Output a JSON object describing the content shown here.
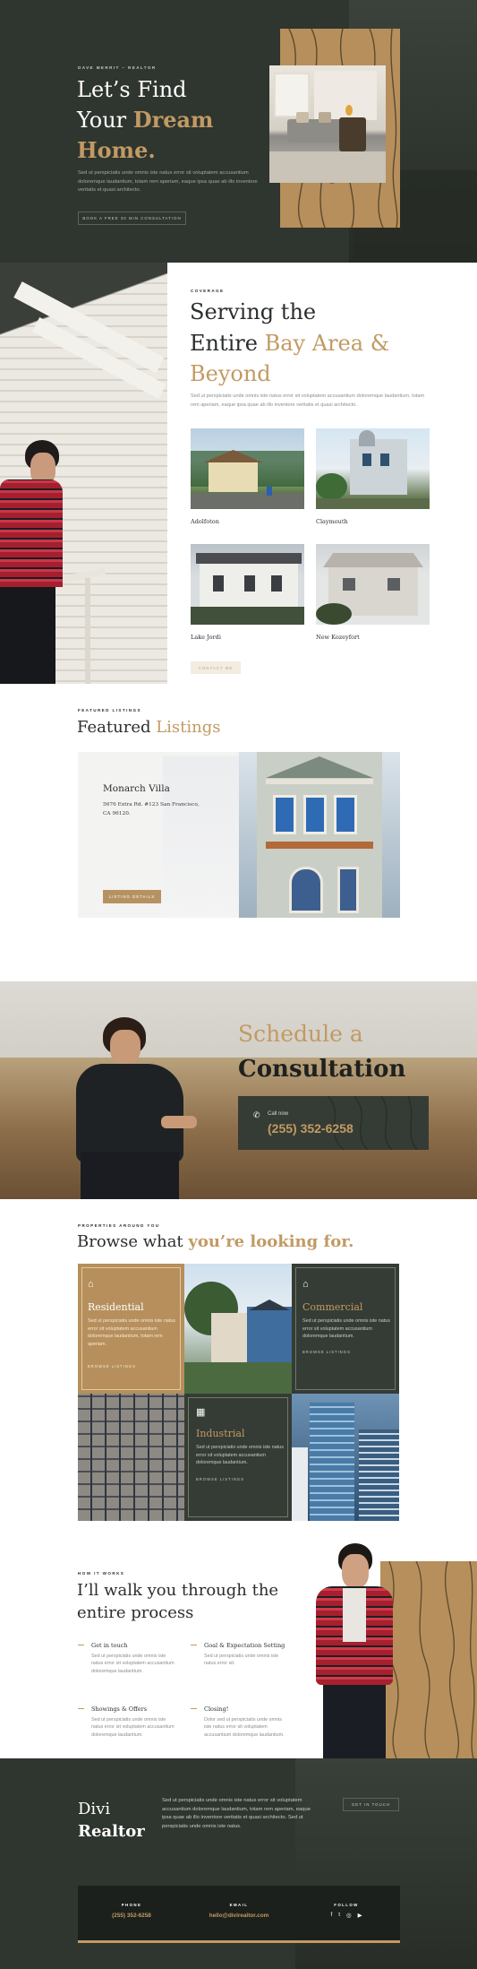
{
  "hero": {
    "eyebrow": "DAVE MERRIT – REALTOR",
    "title_line1": "Let’s Find",
    "title_line2_plain": "Your ",
    "title_line2_accent": "Dream",
    "title_line3_accent": "Home.",
    "body": "Sed ut perspiciatis unde omnis iste natus error sit voluptatem accusantium doloremque laudantium, totam rem aperiam, eaque ipsa quae ab illo inventore veritatis et quasi architecto.",
    "cta": "BOOK A FREE 30 MIN CONSULTATION"
  },
  "coverage": {
    "eyebrow": "COVERAGE",
    "title_line1": "Serving the",
    "title_line2_plain": "Entire ",
    "title_line2_accent": "Bay Area &",
    "title_line3_accent": "Beyond",
    "body": "Sed ut perspiciatis unde omnis iste natus error sit voluptatem accusantium doloremque laudantium, totam rem aperiam, eaque ipsa quae ab illo inventore veritatis et quasi architecto.",
    "cities": [
      "Adolfoton",
      "Claymouth",
      "Lake Jordi",
      "New Kozeyfort"
    ],
    "cta": "CONTACT ME"
  },
  "featured": {
    "eyebrow": "FEATURED LISTINGS",
    "title_plain": "Featured ",
    "title_accent": "Listings",
    "listing_name": "Monarch Villa",
    "address_line1": "5676 Extra Rd. #123 San Francisco,",
    "address_line2": "CA 96120.",
    "cta": "LISTING DETAILS"
  },
  "consult": {
    "title_accent": "Schedule a",
    "title_dark": "Consultation",
    "call_label": "Call now",
    "phone": "(255) 352-6258"
  },
  "browse": {
    "eyebrow": "PROPERTIES AROUND YOU",
    "title_plain": "Browse what ",
    "title_accent": "you’re looking for.",
    "residential": {
      "title": "Residential",
      "body": "Sed ut perspiciatis unde omnis iste natus error sit voluptatem accusantium doloremque laudantium, totam rem aperiam.",
      "link": "BROWSE LISTINGS"
    },
    "commercial": {
      "title": "Commercial",
      "body": "Sed ut perspiciatis unde omnis iste natus error sit voluptatem accusantium doloremque laudantium.",
      "link": "BROWSE LISTINGS"
    },
    "industrial": {
      "title": "Industrial",
      "body": "Sed ut perspiciatis unde omnis iste natus error sit voluptatem accusantium doloremque laudantium.",
      "link": "BROWSE LISTINGS"
    }
  },
  "process": {
    "eyebrow": "HOW IT WORKS",
    "title_line1": "I’ll walk you through the",
    "title_line2": "entire process",
    "steps": [
      {
        "title": "Get in touch",
        "body": "Sed ut perspiciatis unde omnis iste natus error sit voluptatem accusantium doloremque laudantium."
      },
      {
        "title": "Goal & Expectation Setting",
        "body": "Sed ut perspiciatis unde omnis iste natus error sit."
      },
      {
        "title": "Showings & Offers",
        "body": "Sed ut perspiciatis unde omnis iste natus error sit voluptatem accusantium doloremque laudantium."
      },
      {
        "title": "Closing!",
        "body": "Dolor sed ut perspiciatis unde omnis iste natus error sit voluptatem accusantium doloremque laudantium."
      }
    ]
  },
  "footer": {
    "brand_line1": "Divi",
    "brand_line2": "Realtor",
    "body": "Sed ut perspiciatis unde omnis iste natus error sit voluptatem accusantium doloremque laudantium, totam rem aperiam, eaque ipsa quae ab illo inventore veritatis et quasi architecto. Sed ut perspiciatis unde omnis iste natus.",
    "cta": "GET IN TOUCH",
    "phone_label": "PHONE",
    "phone": "(255) 352-6258",
    "email_label": "EMAIL",
    "email": "hello@divirealtor.com",
    "follow_label": "FOLLOW",
    "social": [
      "f",
      "t",
      "◎",
      "▶"
    ]
  },
  "colors": {
    "accent": "#c29a63",
    "dark": "#2f352f",
    "panel": "#353c35"
  }
}
